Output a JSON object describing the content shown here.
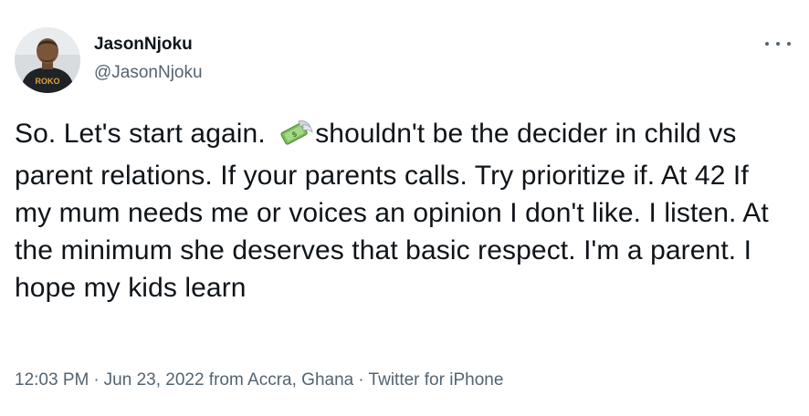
{
  "author": {
    "display_name": "JasonNjoku",
    "handle": "@JasonNjoku",
    "avatar_shirt_text": "ROKO"
  },
  "tweet": {
    "text_before_emoji": "So. Let's start again. ",
    "emoji": "money-with-wings-icon",
    "text_after_emoji": "shouldn't be the decider in child vs parent relations. If your parents calls. Try prioritize if. At 42 If my mum needs me or voices an opinion I don't like. I listen. At the minimum she deserves that basic respect. I'm a parent. I hope my kids learn"
  },
  "meta": {
    "time": "12:03 PM",
    "separator": "·",
    "date_location": "Jun 23, 2022 from Accra, Ghana",
    "source": "Twitter for iPhone"
  },
  "colors": {
    "text_primary": "#0f1419",
    "text_secondary": "#536471",
    "background": "#ffffff"
  }
}
